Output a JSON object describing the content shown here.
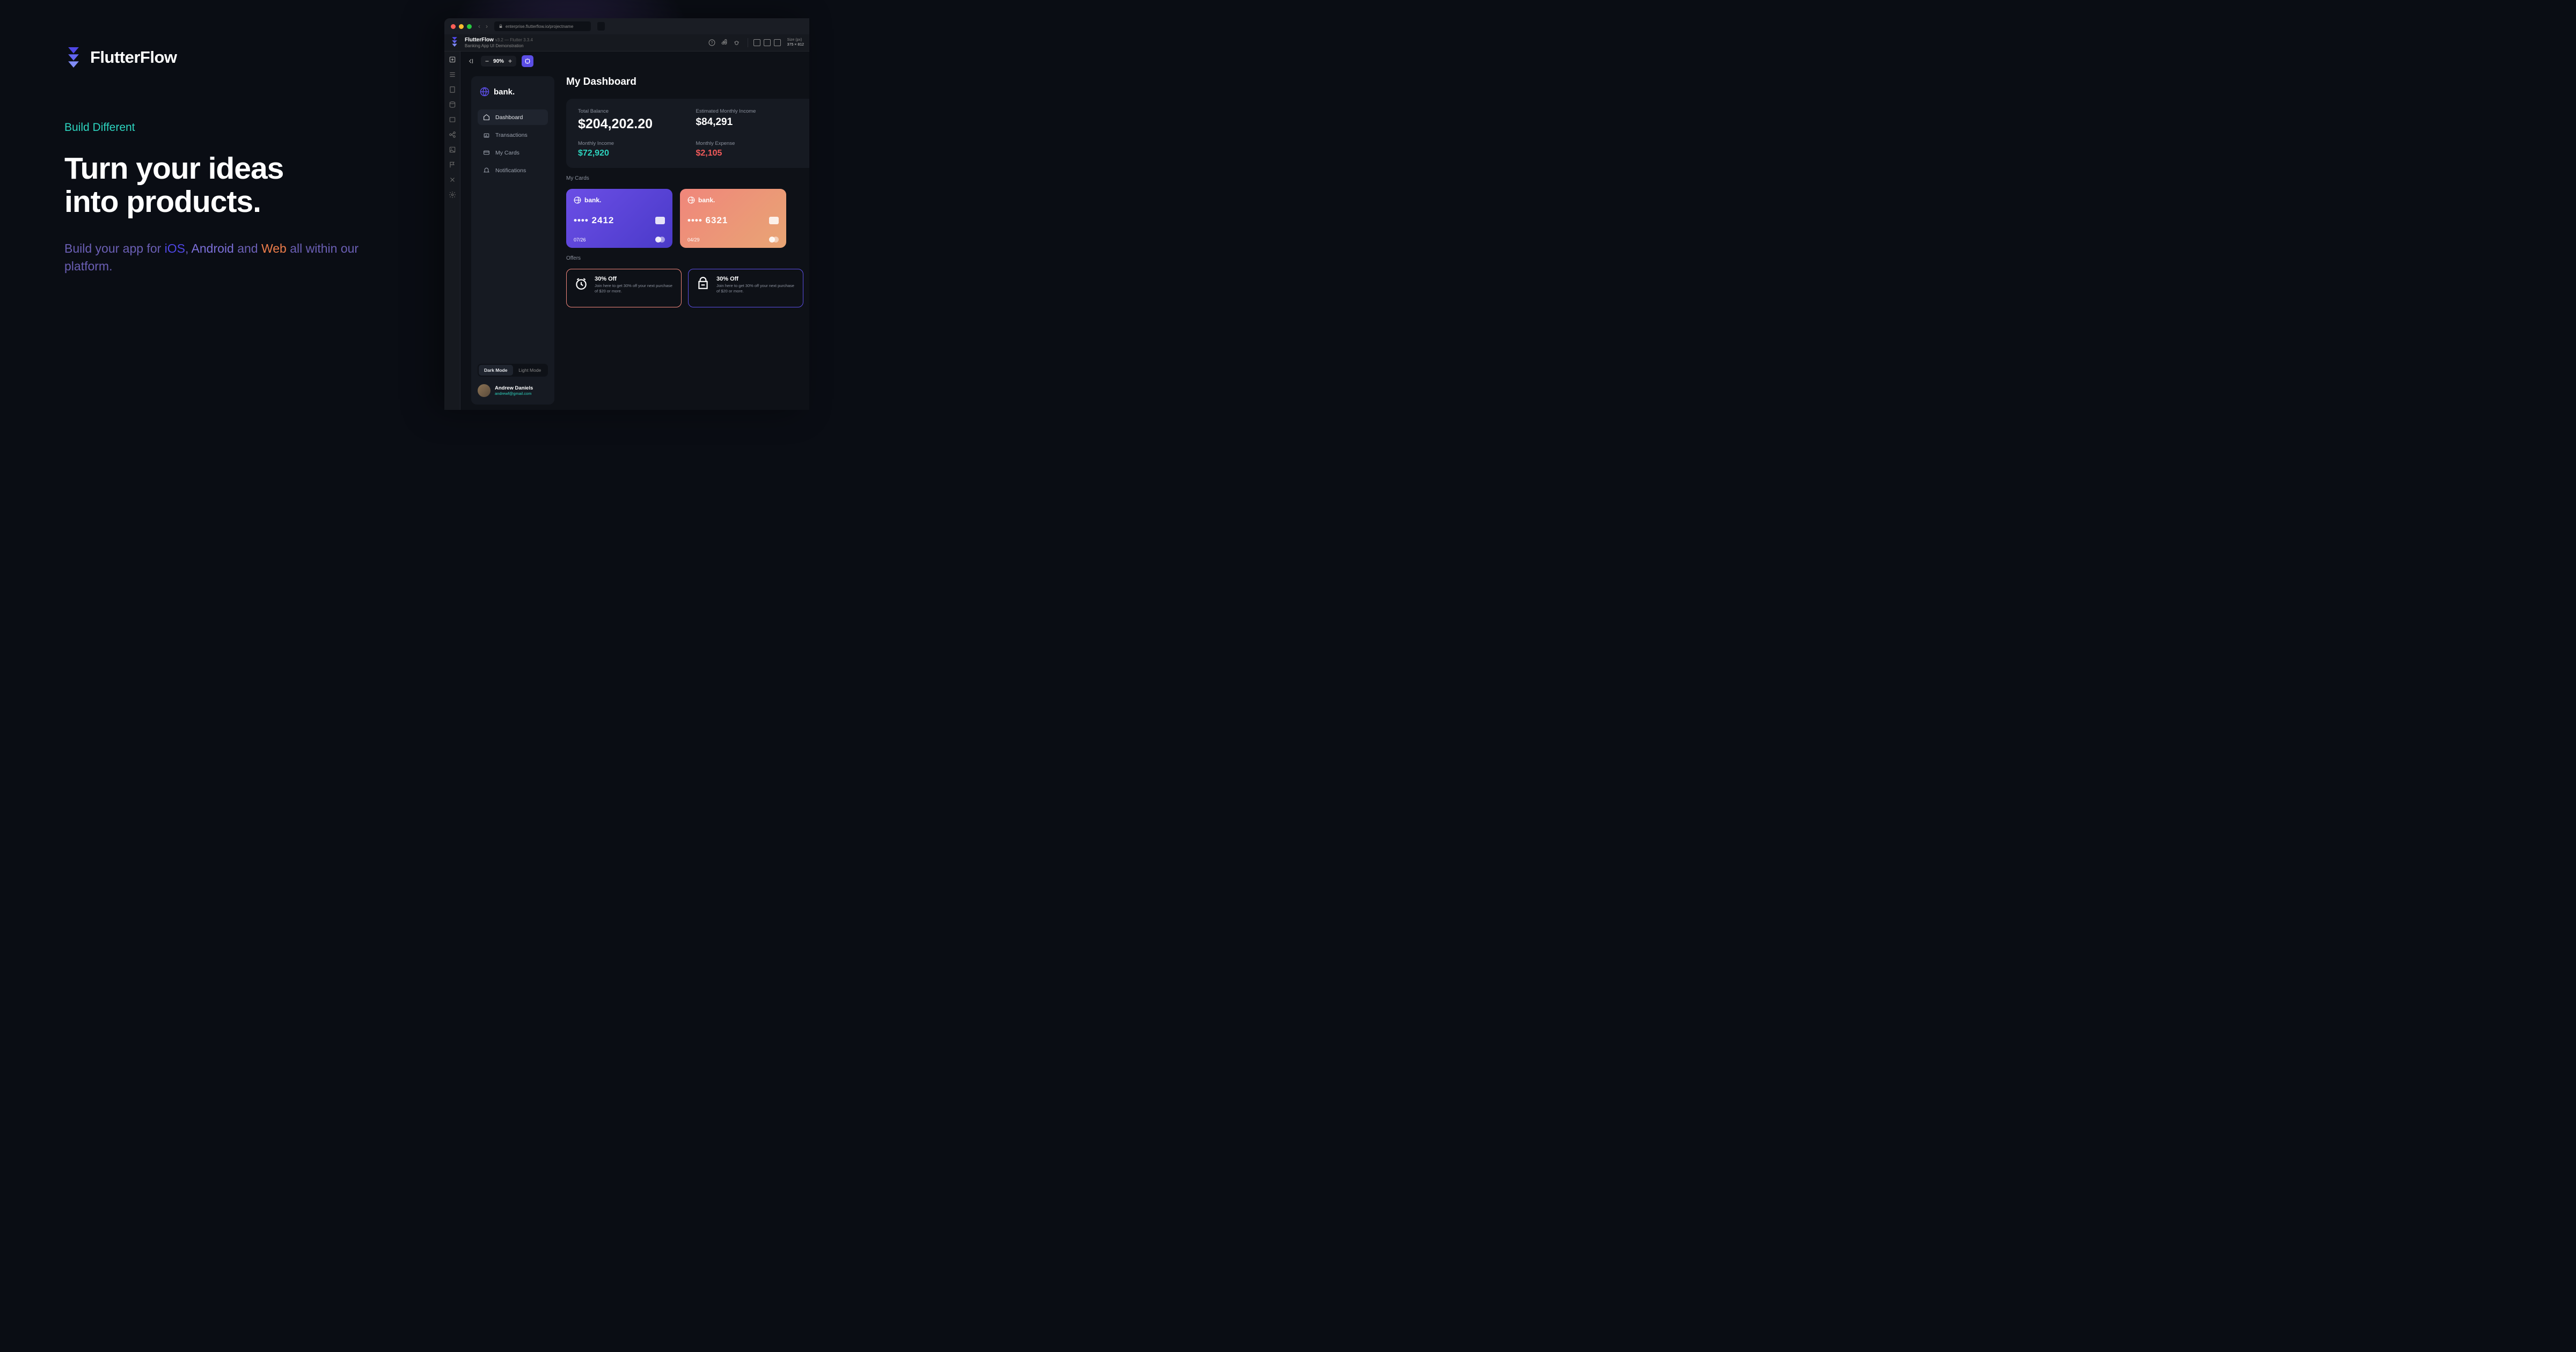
{
  "marketing": {
    "brand": "FlutterFlow",
    "eyebrow": "Build Different",
    "headline_l1": "Turn your ideas",
    "headline_l2": "into products.",
    "subhead_prefix": "Build your app for ",
    "ios": "iOS",
    "comma": ", ",
    "android": "Android",
    "and": " and ",
    "web": "Web",
    "subhead_suffix": " all within our platform."
  },
  "browser": {
    "url": "enterprise.flutterflow.io/projectname"
  },
  "app_header": {
    "title": "FlutterFlow",
    "version": "v3.2 — Flutter 3.3.4",
    "subtitle": "Banking App UI Demonstration",
    "size_label": "Size (px)",
    "size_value": "375 × 812"
  },
  "toolbar": {
    "zoom": "90%"
  },
  "bank_sidebar": {
    "brand": "bank.",
    "nav": [
      {
        "label": "Dashboard"
      },
      {
        "label": "Transactions"
      },
      {
        "label": "My Cards"
      },
      {
        "label": "Notifications"
      }
    ],
    "mode_dark": "Dark Mode",
    "mode_light": "Light Mode",
    "user_name": "Andrew Daniels",
    "user_email": "andrewf@gmail.com"
  },
  "dashboard": {
    "title": "My Dashboard",
    "stats": {
      "total_balance_label": "Total Balance",
      "total_balance_value": "$204,202.20",
      "est_income_label": "Estimated Monthly Income",
      "est_income_value": "$84,291",
      "monthly_income_label": "Monthly Income",
      "monthly_income_value": "$72,920",
      "monthly_expense_label": "Monthly Expense",
      "monthly_expense_value": "$2,105"
    },
    "cards_label": "My Cards",
    "cards": [
      {
        "brand": "bank.",
        "number": "•••• 2412",
        "exp": "07/26"
      },
      {
        "brand": "bank.",
        "number": "•••• 6321",
        "exp": "04/29"
      }
    ],
    "offers_label": "Offers",
    "offers": [
      {
        "title": "30% Off",
        "desc": "Join here to get 30% off your next purchase of $20 or more."
      },
      {
        "title": "30% Off",
        "desc": "Join here to get 30% off your next purchase of $20 or more."
      }
    ]
  }
}
